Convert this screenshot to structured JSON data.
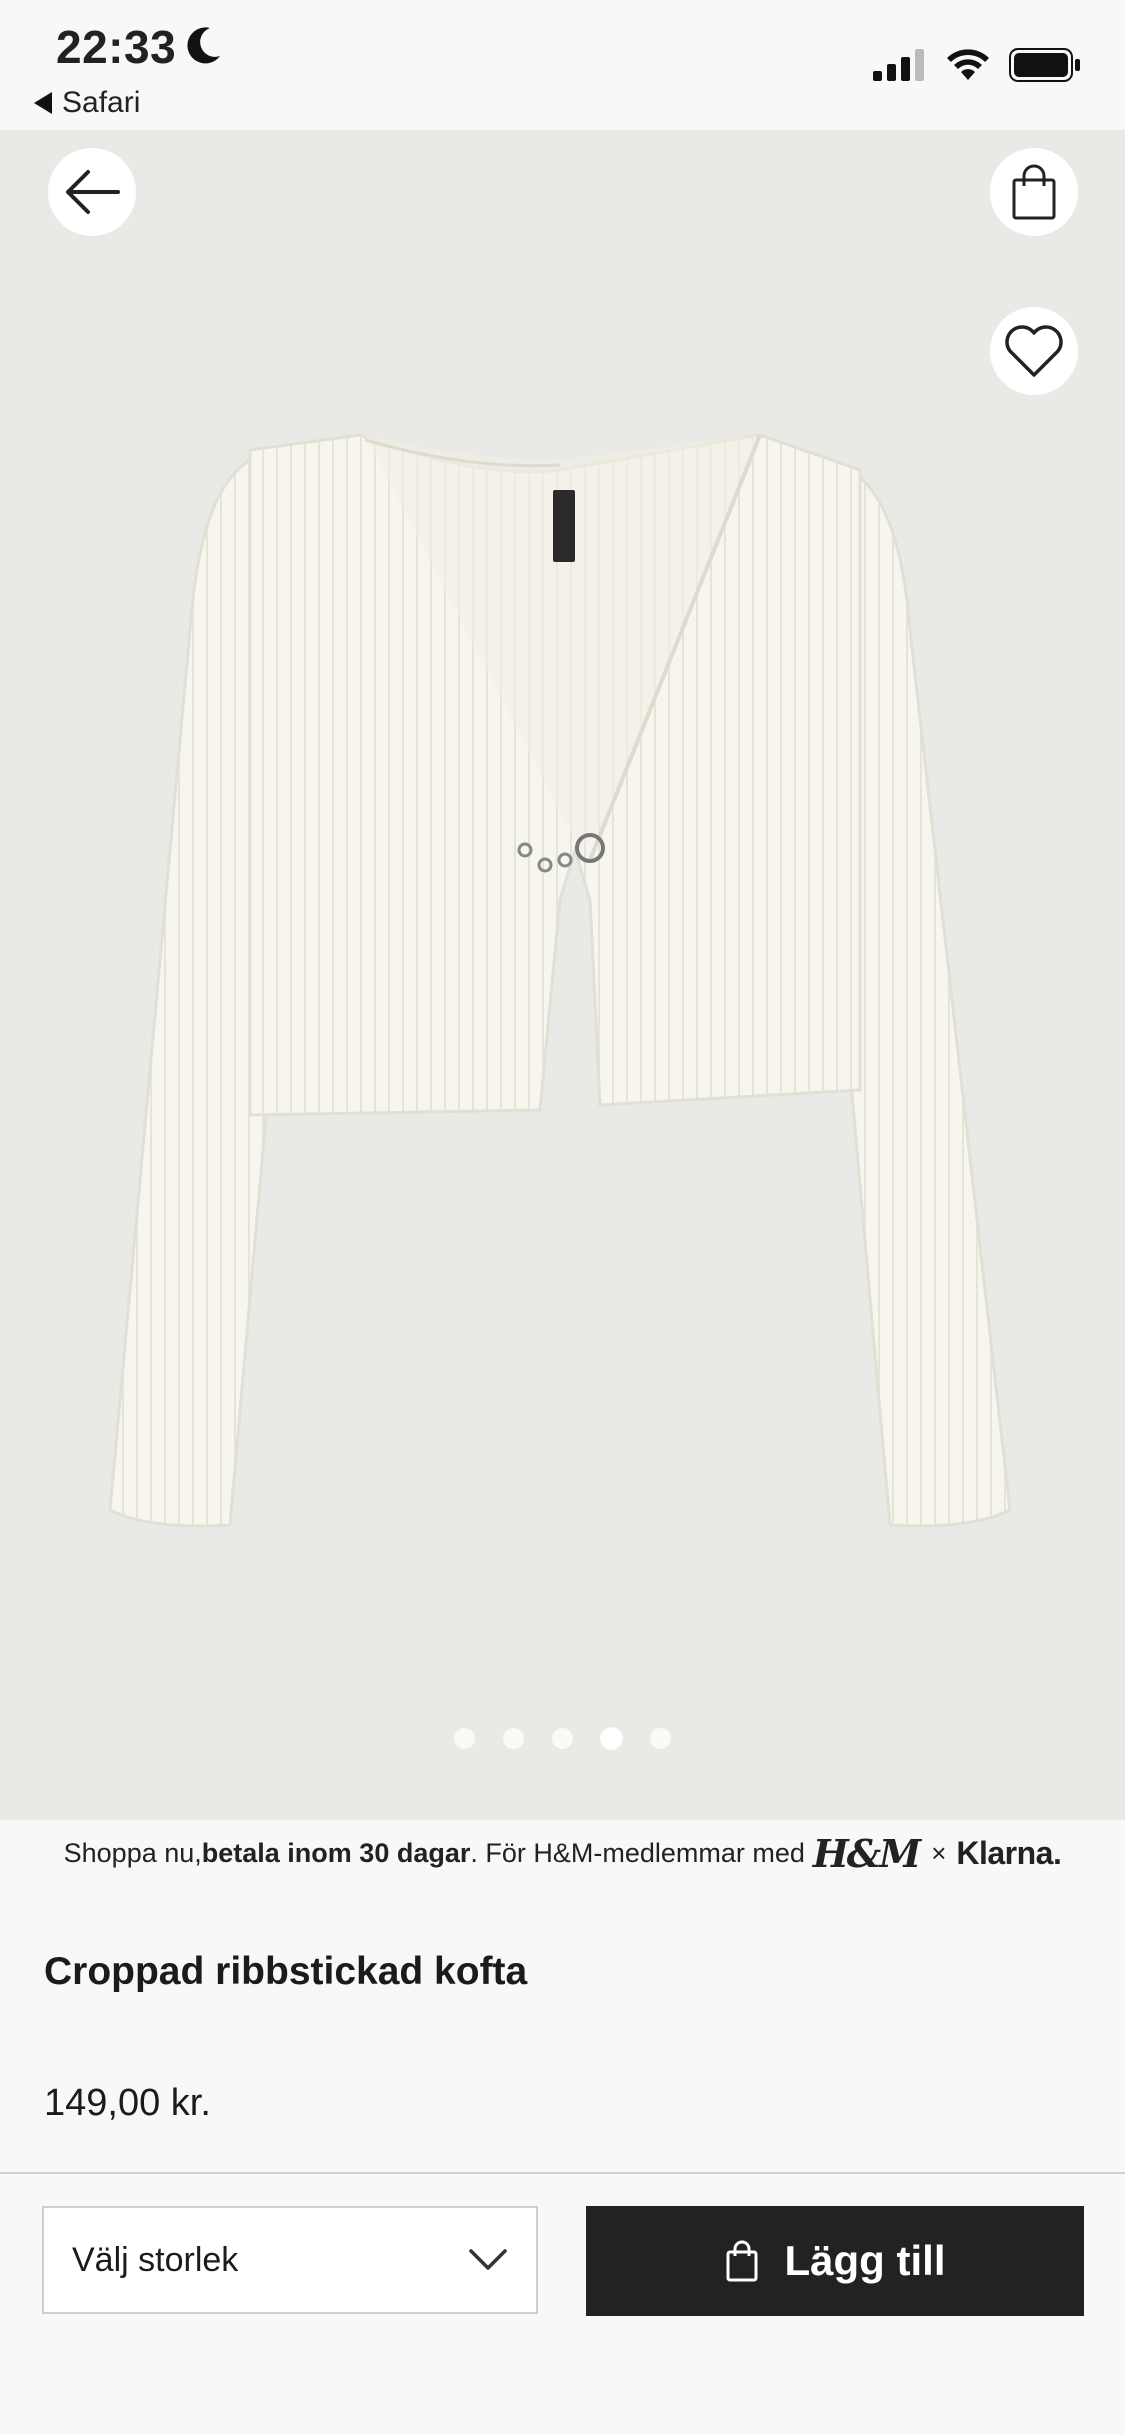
{
  "status_bar": {
    "time": "22:33",
    "back_app": "Safari",
    "icons": [
      "moon-icon",
      "cellular-signal-icon",
      "wifi-icon",
      "battery-icon"
    ]
  },
  "hero": {
    "image_alt": "Croppad ribbstickad kofta",
    "icons": [
      "back-arrow-icon",
      "shopping-bag-icon",
      "heart-icon"
    ],
    "carousel": {
      "count": 5,
      "active_index": 3
    }
  },
  "klarna": {
    "text_1": "Shoppa nu, ",
    "text_bold": "betala inom 30 dagar",
    "text_2": ". För H&M-medlemmar med ",
    "hm_logo": "H&M",
    "times": "×",
    "klarna_logo": "Klarna."
  },
  "product": {
    "title": "Croppad ribbstickad kofta",
    "price": "149,00 kr."
  },
  "actions": {
    "size_placeholder": "Välj storlek",
    "add_label": "Lägg till"
  },
  "colors": {
    "button_dark": "#222222",
    "hero_bg": "#e9e9e6",
    "page_bg": "#f8f8f8"
  }
}
